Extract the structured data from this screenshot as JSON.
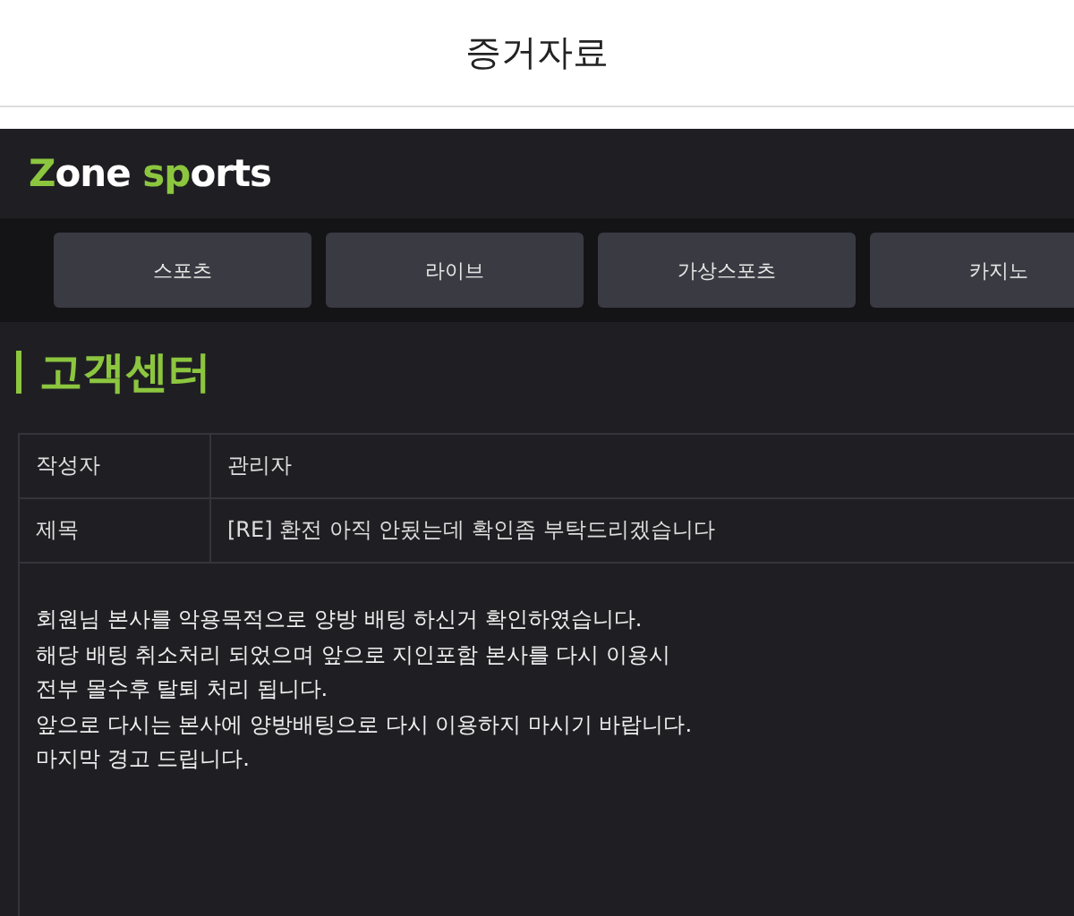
{
  "header": {
    "title": "증거자료"
  },
  "logo": {
    "parts": [
      {
        "text": "Z",
        "accent": true
      },
      {
        "text": "one",
        "accent": false
      },
      {
        "text": " sp",
        "accent": true
      },
      {
        "text": "orts",
        "accent": false
      }
    ]
  },
  "nav": [
    {
      "label": "스포츠"
    },
    {
      "label": "라이브"
    },
    {
      "label": "가상스포츠"
    },
    {
      "label": "카지노"
    }
  ],
  "section_title": "고객센터",
  "post": {
    "fields": [
      {
        "label": "작성자",
        "value": "관리자"
      },
      {
        "label": "제목",
        "value": "[RE] 환전 아직 안됬는데 확인좀 부탁드리겠습니다"
      }
    ],
    "body": [
      "회원님 본사를 악용목적으로 양방 배팅 하신거 확인하였습니다.",
      "해당 배팅 취소처리 되었으며 앞으로 지인포함 본사를 다시 이용시",
      "전부 몰수후 탈퇴 처리 됩니다.",
      "앞으로 다시는 본사에 양방배팅으로 다시 이용하지 마시기 바랍니다.",
      "마지막 경고 드립니다."
    ]
  }
}
